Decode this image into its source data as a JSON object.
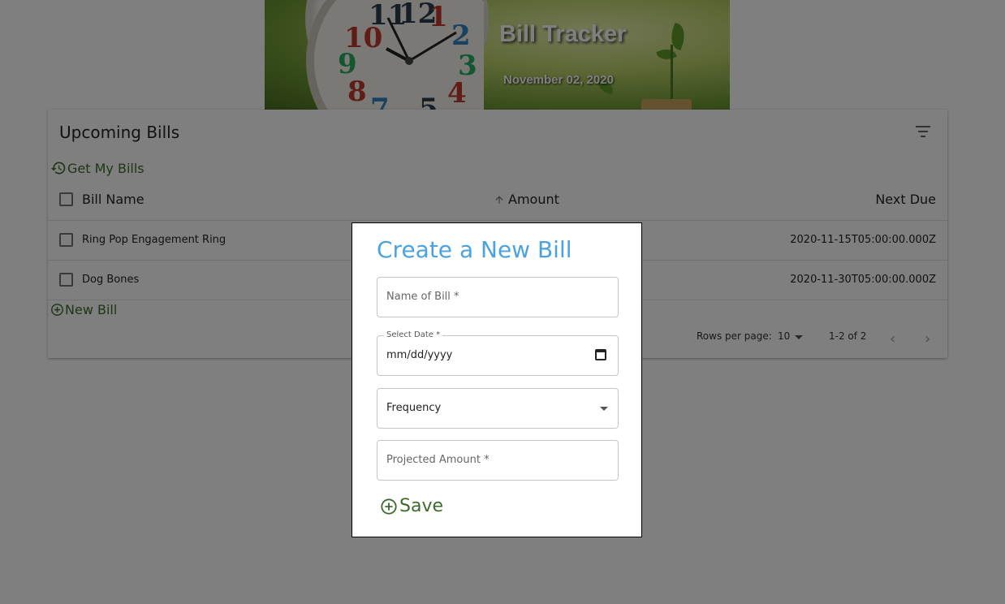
{
  "banner": {
    "title": "Bill Tracker",
    "date": "November 02, 2020",
    "clock_numbers": [
      "12",
      "1",
      "2",
      "3",
      "4",
      "5",
      "7",
      "8",
      "9",
      "10",
      "11"
    ]
  },
  "table": {
    "title": "Upcoming Bills",
    "get_bills_label": "Get My Bills",
    "columns": {
      "name": "Bill Name",
      "amount": "Amount",
      "next_due": "Next Due"
    },
    "rows": [
      {
        "name": "Ring Pop Engagement Ring",
        "next_due": "2020-11-15T05:00:00.000Z"
      },
      {
        "name": "Dog Bones",
        "next_due": "2020-11-30T05:00:00.000Z"
      }
    ],
    "new_bill_label": "New Bill",
    "pagination": {
      "rows_per_page_label": "Rows per page:",
      "rows_per_page_value": "10",
      "range": "1-2 of 2"
    }
  },
  "modal": {
    "title": "Create a New Bill",
    "name_placeholder": "Name of Bill *",
    "date_label": "Select Date *",
    "date_value": "mm/dd/yyyy",
    "frequency_value": "Frequency",
    "amount_placeholder": "Projected Amount *",
    "save_label": "Save"
  },
  "colors": {
    "accent_blue": "#4aa3df",
    "action_green": "#3e6b2c",
    "overlay": "rgba(0,0,0,0.5)"
  },
  "icons": {
    "history": "history-icon",
    "filter": "filter-list-icon",
    "add_circle": "add-circle-icon",
    "sort_arrow": "arrow-up-icon",
    "calendar": "calendar-icon",
    "dropdown": "arrow-drop-down-icon"
  }
}
